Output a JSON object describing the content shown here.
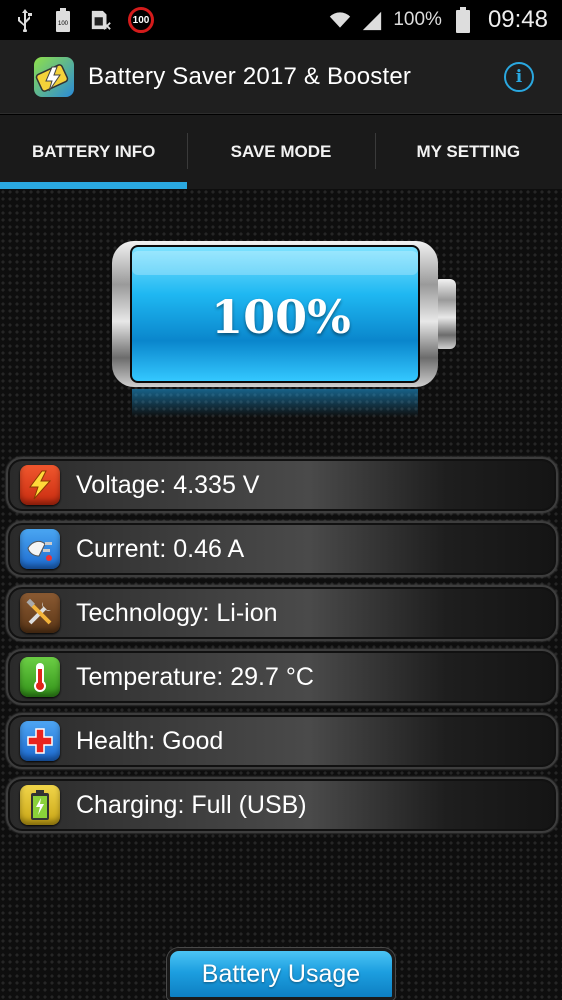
{
  "status_bar": {
    "icons": [
      "usb-icon",
      "battery-100-icon",
      "sim-card-icon",
      "speed-limit-100-icon",
      "wifi-icon",
      "signal-icon",
      "battery-icon"
    ],
    "notif_badge": "100",
    "battery_pct": "100%",
    "time": "09:48"
  },
  "app_bar": {
    "title": "Battery Saver 2017 & Booster",
    "info_label": "i"
  },
  "tabs": [
    {
      "label": "BATTERY INFO",
      "active": true
    },
    {
      "label": "SAVE MODE",
      "active": false
    },
    {
      "label": "MY SETTING",
      "active": false
    }
  ],
  "battery": {
    "percent_label": "100%",
    "level": 1.0
  },
  "info_rows": [
    {
      "icon": "lightning-icon",
      "label": "Voltage: 4.335 V"
    },
    {
      "icon": "plug-icon",
      "label": "Current: 0.46 A"
    },
    {
      "icon": "tools-icon",
      "label": "Technology: Li-ion"
    },
    {
      "icon": "thermometer-icon",
      "label": "Temperature: 29.7 °C"
    },
    {
      "icon": "health-cross-icon",
      "label": "Health: Good"
    },
    {
      "icon": "charging-battery-icon",
      "label": "Charging: Full (USB)"
    }
  ],
  "bottom_button": {
    "label": "Battery Usage"
  },
  "colors": {
    "accent": "#2aa8e0",
    "battery_blue": "#1fa6ec"
  }
}
